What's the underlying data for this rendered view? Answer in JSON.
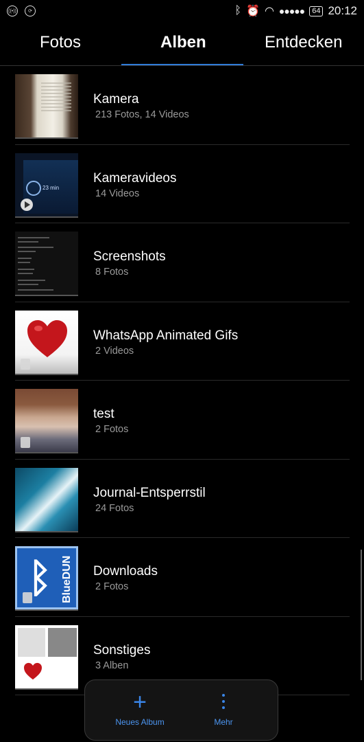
{
  "status_bar": {
    "time": "20:12",
    "battery": "64",
    "signal": "●●●●●",
    "left_icon_text": "((•))"
  },
  "tabs": [
    {
      "label": "Fotos"
    },
    {
      "label": "Alben"
    },
    {
      "label": "Entdecken"
    }
  ],
  "active_tab": "Alben",
  "albums": [
    {
      "title": "Kamera",
      "subtitle": "213 Fotos,  14 Videos"
    },
    {
      "title": "Kameravideos",
      "subtitle": "14 Videos"
    },
    {
      "title": "Screenshots",
      "subtitle": "8 Fotos"
    },
    {
      "title": "WhatsApp Animated Gifs",
      "subtitle": "2 Videos"
    },
    {
      "title": "test",
      "subtitle": "2 Fotos"
    },
    {
      "title": "Journal-Entsperrstil",
      "subtitle": "24 Fotos"
    },
    {
      "title": "Downloads",
      "subtitle": "2 Fotos"
    },
    {
      "title": "Sonstiges",
      "subtitle": "3 Alben"
    }
  ],
  "thumbnail_text": {
    "downloads_logo": "BlueDUN",
    "kameravideos_time": "23 min"
  },
  "toolbar": {
    "new_album_label": "Neues Album",
    "more_label": "Mehr"
  },
  "colors": {
    "accent": "#2f7bd8",
    "background": "#000000",
    "subtitle": "#9a9a9a"
  }
}
